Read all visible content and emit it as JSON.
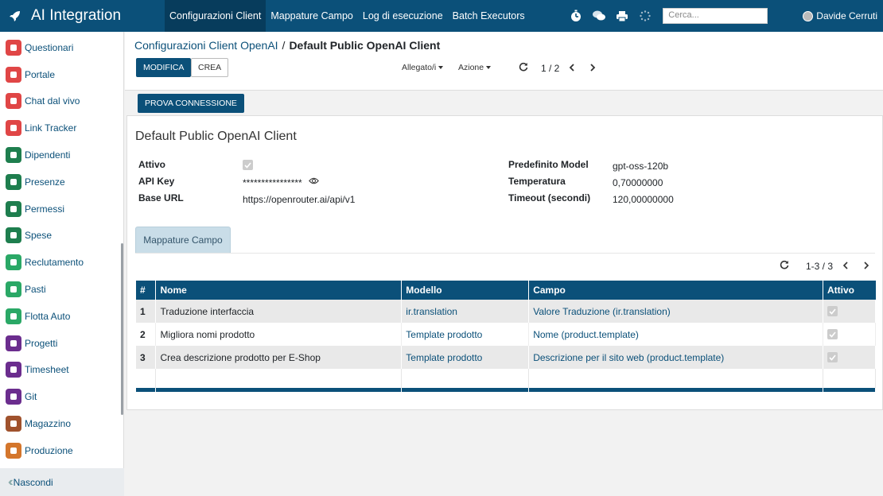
{
  "app": {
    "title": "AI Integration"
  },
  "topnav": {
    "items": [
      "Configurazioni Client",
      "Mappature Campo",
      "Log di esecuzione",
      "Batch Executors"
    ],
    "active_index": 0,
    "search_placeholder": "Cerca...",
    "user_name": "Davide Cerruti",
    "icons": [
      "activity-clock-icon",
      "chat-icon",
      "print-icon",
      "spinner-icon"
    ]
  },
  "sidebar": {
    "items": [
      {
        "label": "Questionari",
        "color": "#e04646",
        "icon": "survey-icon"
      },
      {
        "label": "Portale",
        "color": "#e04646",
        "icon": "portal-icon"
      },
      {
        "label": "Chat dal vivo",
        "color": "#e04646",
        "icon": "livechat-icon"
      },
      {
        "label": "Link Tracker",
        "color": "#e04646",
        "icon": "link-icon"
      },
      {
        "label": "Dipendenti",
        "color": "#1e7e4e",
        "icon": "employees-icon"
      },
      {
        "label": "Presenze",
        "color": "#1e7e4e",
        "icon": "attendance-icon"
      },
      {
        "label": "Permessi",
        "color": "#1e7e4e",
        "icon": "timeoff-icon"
      },
      {
        "label": "Spese",
        "color": "#1e7e4e",
        "icon": "expenses-icon"
      },
      {
        "label": "Reclutamento",
        "color": "#2aa866",
        "icon": "recruitment-icon"
      },
      {
        "label": "Pasti",
        "color": "#2aa866",
        "icon": "lunch-icon"
      },
      {
        "label": "Flotta Auto",
        "color": "#2aa866",
        "icon": "fleet-icon"
      },
      {
        "label": "Progetti",
        "color": "#6b2d8e",
        "icon": "project-icon"
      },
      {
        "label": "Timesheet",
        "color": "#6b2d8e",
        "icon": "timesheet-icon"
      },
      {
        "label": "Git",
        "color": "#6b2d8e",
        "icon": "git-icon"
      },
      {
        "label": "Magazzino",
        "color": "#a0522d",
        "icon": "inventory-icon"
      },
      {
        "label": "Produzione",
        "color": "#d4762c",
        "icon": "manufacturing-icon"
      }
    ],
    "collapse_label": "Nascondi"
  },
  "control": {
    "breadcrumb_parent": "Configurazioni Client OpenAI",
    "breadcrumb_separator": "/",
    "breadcrumb_current": "Default Public OpenAI Client",
    "edit_label": "MODIFICA",
    "create_label": "CREA",
    "attachments_label": "Allegato/i",
    "action_label": "Azione",
    "pager_value": "1 / 2"
  },
  "statusbar": {
    "test_connection_label": "PROVA CONNESSIONE"
  },
  "record": {
    "title": "Default Public OpenAI Client",
    "left_fields": [
      {
        "label": "Attivo",
        "value": "",
        "type": "checkbox",
        "checked": true
      },
      {
        "label": "API Key",
        "value": "****************",
        "type": "password"
      },
      {
        "label": "Base URL",
        "value": "https://openrouter.ai/api/v1",
        "type": "text"
      }
    ],
    "right_fields": [
      {
        "label": "Predefinito Model",
        "value": "gpt-oss-120b"
      },
      {
        "label": "Temperatura",
        "value": "0,70000000"
      },
      {
        "label": "Timeout (secondi)",
        "value": "120,00000000"
      }
    ]
  },
  "tab": {
    "label": "Mappature Campo"
  },
  "mappings": {
    "pager": "1-3 / 3",
    "columns": [
      "#",
      "Nome",
      "Modello",
      "Campo",
      "Attivo"
    ],
    "rows": [
      {
        "num": "1",
        "name": "Traduzione interfaccia",
        "model": "ir.translation",
        "field": "Valore Traduzione (ir.translation)",
        "active": true
      },
      {
        "num": "2",
        "name": "Migliora nomi prodotto",
        "model": "Template prodotto",
        "field": "Nome (product.template)",
        "active": true
      },
      {
        "num": "3",
        "name": "Crea descrizione prodotto per E-Shop",
        "model": "Template prodotto",
        "field": "Descrizione per il sito web (product.template)",
        "active": true
      }
    ]
  }
}
